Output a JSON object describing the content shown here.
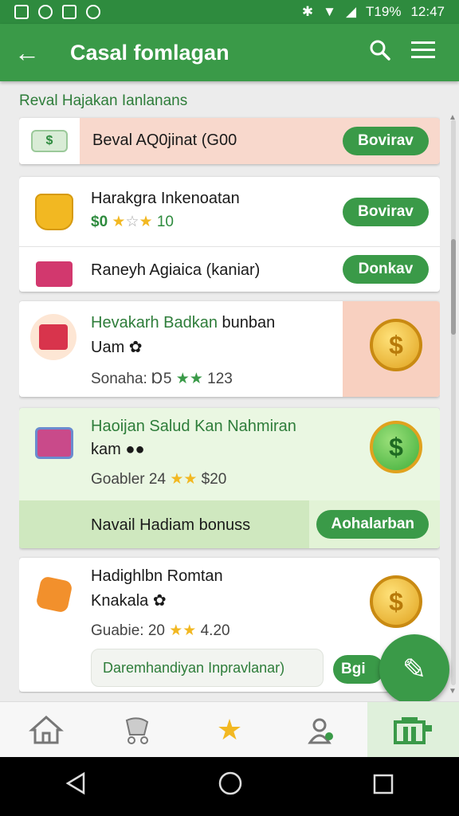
{
  "status": {
    "battery": "T19%",
    "time": "12:47"
  },
  "app_bar": {
    "title": "Casal fomlagan"
  },
  "section_title": "Reval Hajakan Ianlanans",
  "items": [
    {
      "name": "Beval AQ0jinat (G00",
      "button": "Bovirav"
    },
    {
      "name": "Harakgra Inkenoatan",
      "price": "$0",
      "rating": "10",
      "button": "Bovirav"
    },
    {
      "name": "Raneyh Agiaica (kaniar)",
      "button": "Donkav"
    },
    {
      "name_green": "Hevakarh Badkan",
      "name_rest": "bunban",
      "line2": "Uam",
      "meta_label": "Sonaha:",
      "meta_a": "Ɒ5",
      "meta_b": "123"
    },
    {
      "name": "Haoijan Salud Kan Nahmiran",
      "line2": "kam",
      "meta_label": "Goabler",
      "meta_a": "24",
      "meta_b": "$20",
      "bonus": "Navail Hadiam bonuss",
      "button": "Aohalarban"
    },
    {
      "name": "Hadighlbn Romtan",
      "line2": "Knakala",
      "meta_label": "Guabie:",
      "meta_a": "20",
      "meta_b": "4.20",
      "chip": "Daremhandiyan Inpravlanar)",
      "button": "Bgi"
    }
  ],
  "icons": {
    "back": "arrow-left-icon",
    "search": "search-icon",
    "menu": "menu-icon",
    "home": "home-icon",
    "stroller": "stroller-icon",
    "star": "star-icon",
    "profile": "profile-icon",
    "shop": "shop-icon",
    "edit": "edit-icon"
  },
  "colors": {
    "primary": "#3a9a48",
    "highlight_bg": "#f8d8cc",
    "green_card_bg": "#eaf7e2"
  }
}
